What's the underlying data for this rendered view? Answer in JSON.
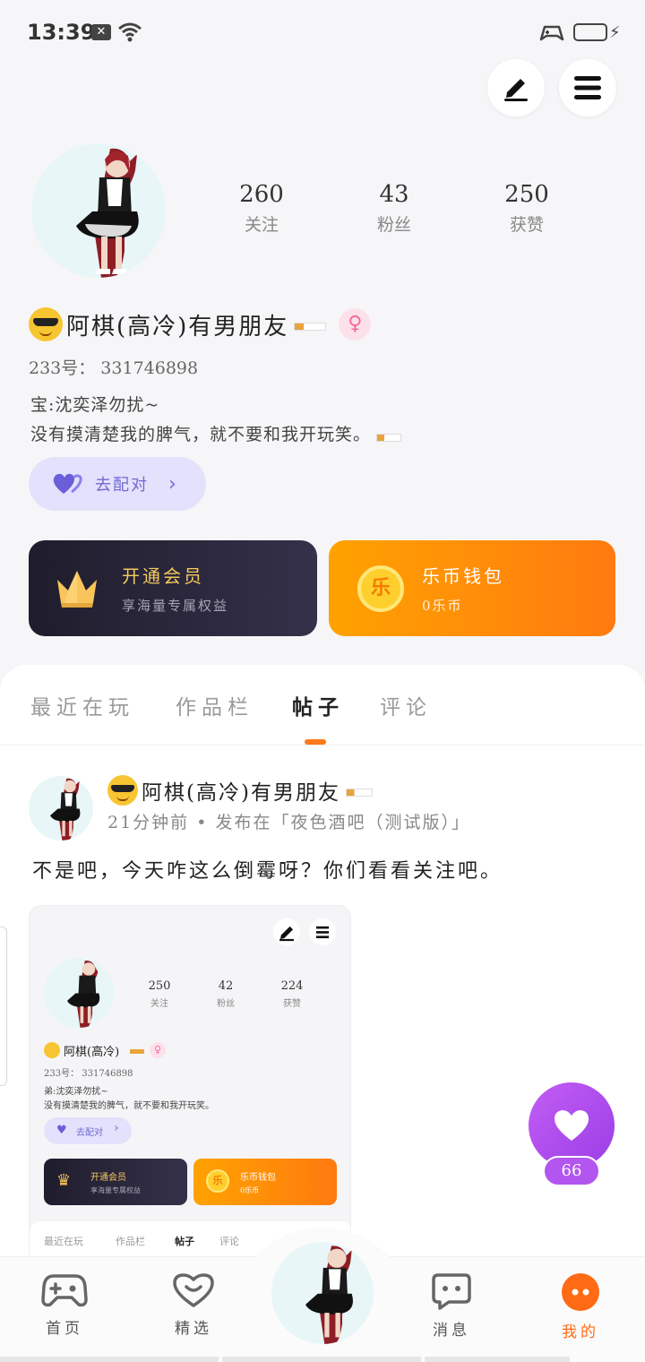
{
  "status_bar": {
    "time": "13:39"
  },
  "profile": {
    "stats": [
      {
        "value": "260",
        "label": "关注"
      },
      {
        "value": "43",
        "label": "粉丝"
      },
      {
        "value": "250",
        "label": "获赞"
      }
    ],
    "name": "阿棋(高冷)有男朋友",
    "id_line": "233号：  331746898",
    "bio_line1": "宝:沈奕泽勿扰~",
    "bio_line2": "没有摸清楚我的脾气，就不要和我开玩笑。",
    "pair_button": "去配对",
    "vip_card": {
      "title": "开通会员",
      "subtitle": "享海量专属权益"
    },
    "wallet_card": {
      "title": "乐币钱包",
      "subtitle": "0乐币",
      "coin_glyph": "乐"
    }
  },
  "tabs": [
    "最近在玩",
    "作品栏",
    "帖子",
    "评论"
  ],
  "active_tab": "帖子",
  "post": {
    "author": "阿棋(高冷)有男朋友",
    "meta": "21分钟前 • 发布在「夜色酒吧（测试版）」",
    "text": "不是吧，今天咋这么倒霉呀？你们看看关注吧。",
    "screenshot": {
      "stats": [
        {
          "value": "250",
          "label": "关注"
        },
        {
          "value": "42",
          "label": "粉丝"
        },
        {
          "value": "224",
          "label": "获赞"
        }
      ],
      "name": "阿棋(高冷)",
      "id_line": "233号：  331746898",
      "bio_line1": "弟:沈奕泽勿扰~",
      "bio_line2": "没有摸清楚我的脾气，就不要和我开玩笑。",
      "pair_button": "去配对",
      "vip_title": "开通会员",
      "vip_sub": "享海量专属权益",
      "wallet_title": "乐币钱包",
      "wallet_sub": "0乐币",
      "coin_glyph": "乐",
      "tabs": [
        "最近在玩",
        "作品栏",
        "帖子",
        "评论"
      ]
    }
  },
  "like_count": "66",
  "bottom_nav": [
    {
      "label": "首页",
      "icon": "gamepad-icon"
    },
    {
      "label": "精选",
      "icon": "heart-outline-icon"
    },
    {
      "label": "",
      "icon": "avatar-center"
    },
    {
      "label": "消息",
      "icon": "chat-icon"
    },
    {
      "label": "我的",
      "icon": "profile-face-icon"
    }
  ],
  "colors": {
    "accent_orange": "#ff7a1a",
    "pair_purple": "#7069d0",
    "like_purple": "#b256ef",
    "vip_gold": "#f7c95d"
  }
}
